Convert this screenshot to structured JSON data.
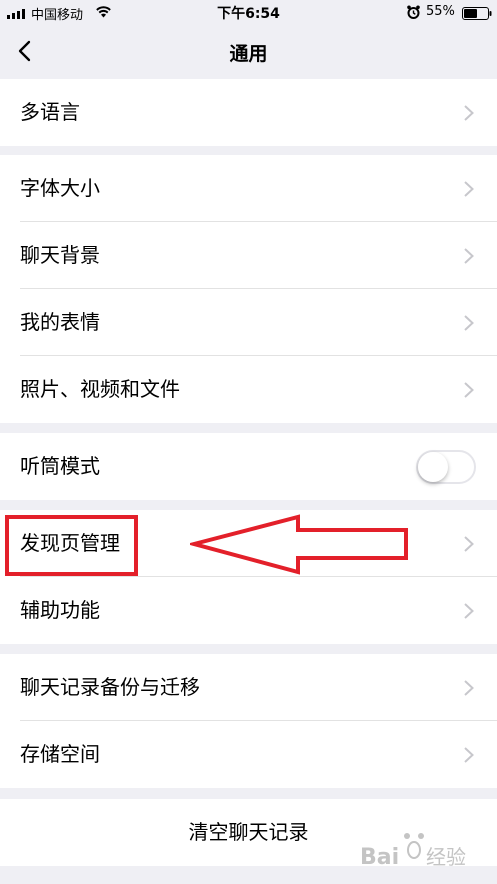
{
  "status_bar": {
    "carrier": "中国移动",
    "time": "下午6:54",
    "battery_percent": "55%",
    "icons": [
      "signal-icon",
      "wifi-icon",
      "alarm-icon",
      "battery-icon"
    ]
  },
  "nav": {
    "title": "通用",
    "back_icon": "chevron-left-icon"
  },
  "sections": {
    "language": {
      "label": "多语言"
    },
    "display": [
      {
        "label": "字体大小"
      },
      {
        "label": "聊天背景"
      },
      {
        "label": "我的表情"
      },
      {
        "label": "照片、视频和文件"
      }
    ],
    "earpiece": {
      "label": "听筒模式",
      "toggle_on": false
    },
    "discover": [
      {
        "label": "发现页管理"
      },
      {
        "label": "辅助功能"
      }
    ],
    "storage": [
      {
        "label": "聊天记录备份与迁移"
      },
      {
        "label": "存储空间"
      }
    ],
    "clear": {
      "label": "清空聊天记录"
    }
  },
  "annotation": {
    "color": "#e3202a",
    "highlight_target": "发现页管理"
  },
  "watermark": {
    "text": "Bai du 经验",
    "color": "#c0c0c0"
  }
}
